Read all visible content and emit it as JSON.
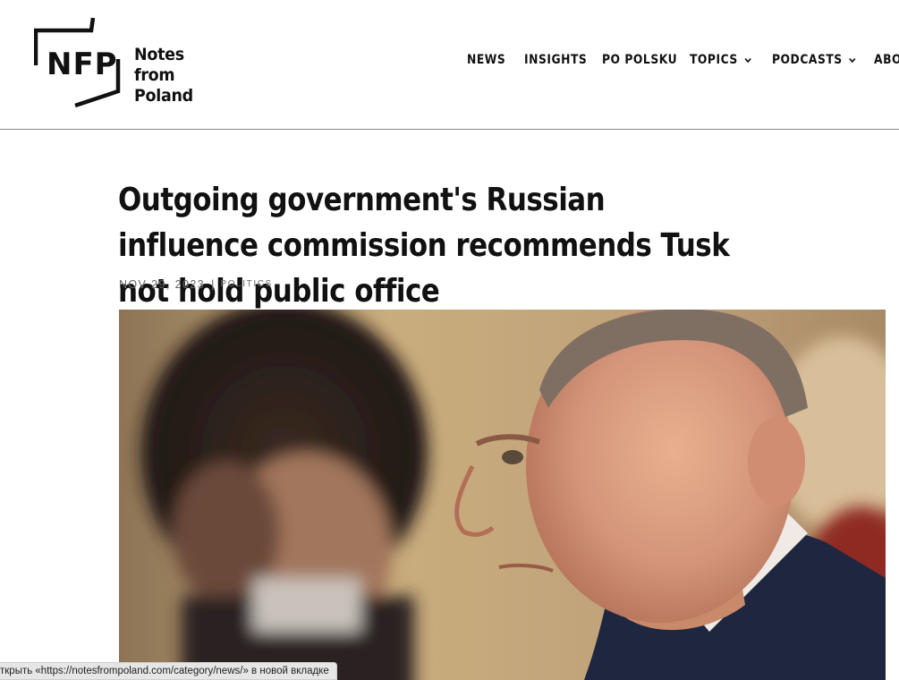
{
  "header": {
    "logo_mark_text": "NFP",
    "logo_name": "Notes from\nPoland",
    "nav": [
      {
        "label": "NEWS",
        "has_dropdown": false
      },
      {
        "label": "INSIGHTS",
        "has_dropdown": false
      },
      {
        "label": "PO POLSKU",
        "has_dropdown": false
      },
      {
        "label": "TOPICS",
        "has_dropdown": true
      },
      {
        "label": "PODCASTS",
        "has_dropdown": true
      },
      {
        "label": "ABOU",
        "has_dropdown": false
      }
    ]
  },
  "article": {
    "title": "Outgoing government's Russian influence commission recommends Tusk not hold public office",
    "date": "NOV 29, 2023",
    "separator": "|",
    "category": "POLITICS",
    "image_alt": "Donald Tusk"
  },
  "status_bar": {
    "text": "ткрыть «https://notesfrompoland.com/category/news/» в новой вкладке"
  },
  "icons": {
    "dropdown": "chevron-down-icon"
  }
}
